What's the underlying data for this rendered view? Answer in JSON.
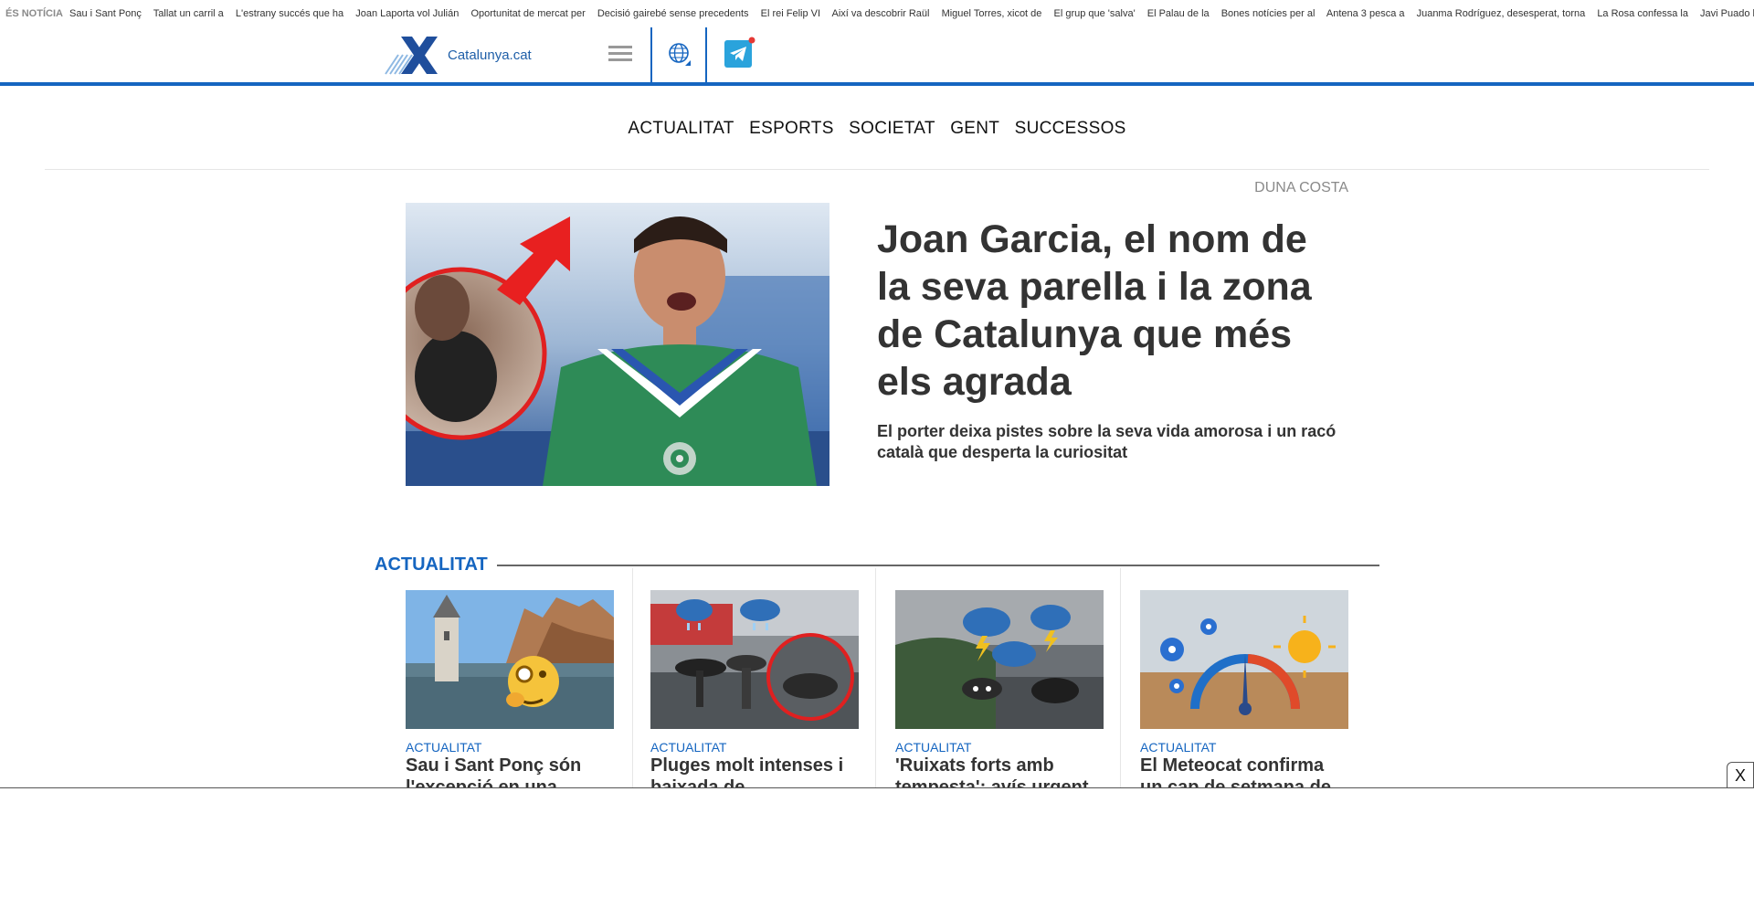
{
  "ticker": {
    "label": "ÉS NOTÍCIA",
    "items": [
      "Sau i Sant Ponç",
      "Tallat un carril a",
      "L'estrany succés que ha",
      "Joan Laporta vol Julián",
      "Oportunitat de mercat per",
      "Decisió gairebé sense precedents",
      "El rei Felip VI",
      "Així va descobrir Raül",
      "Miguel Torres, xicot de",
      "El grup que 'salva'",
      "El Palau de la",
      "Bones notícies per al",
      "Antena 3 pesca a",
      "Juanma Rodríguez, desesperat, torna",
      "La Rosa confessa la",
      "Javi Puado ho reconeix"
    ]
  },
  "header": {
    "logo_text": "Catalunya.cat",
    "brand_color": "#1565c0",
    "icons": [
      "menu-icon",
      "globe-icon",
      "telegram-icon"
    ]
  },
  "nav": {
    "items": [
      "ACTUALITAT",
      "ESPORTS",
      "SOCIETAT",
      "GENT",
      "SUCCESSOS"
    ]
  },
  "featured": {
    "author": "DUNA COSTA",
    "title": "Joan Garcia, el nom de la seva parella i la zona de Catalunya que més els agrada",
    "subtitle": "El porter deixa pistes sobre la seva vida amorosa i un racó català que desperta la curiositat"
  },
  "section": {
    "title": "ACTUALITAT",
    "cards": [
      {
        "category": "ACTUALITAT",
        "title": "Sau i Sant Ponç són l'excepció en una"
      },
      {
        "category": "ACTUALITAT",
        "title": "Pluges molt intenses i baixada de"
      },
      {
        "category": "ACTUALITAT",
        "title": "'Ruixats forts amb tempesta': avís urgent"
      },
      {
        "category": "ACTUALITAT",
        "title": "El Meteocat confirma un cap de setmana de"
      }
    ]
  },
  "overlay": {
    "close_label": "X"
  }
}
